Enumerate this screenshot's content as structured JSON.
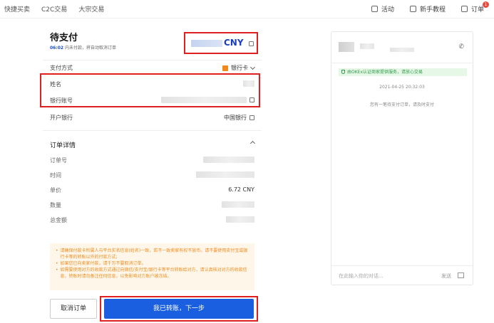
{
  "nav": {
    "left": [
      "快捷买卖",
      "C2C交易",
      "大宗交易"
    ],
    "activity": "活动",
    "tutorial": "新手教程",
    "orders": "订单",
    "orders_badge": "1"
  },
  "order": {
    "title": "待支付",
    "timer": "06:02",
    "timer_suffix": "内未付款，将自动取消订单",
    "currency": "CNY",
    "payment_method_label": "支付方式",
    "payment_method_value": "银行卡",
    "name_label": "姓名",
    "account_label": "银行账号",
    "bank_label": "开户银行",
    "bank_value": "中国银行",
    "details_title": "订单详情",
    "order_no_label": "订单号",
    "time_label": "时间",
    "price_label": "单价",
    "price_value": "6.72 CNY",
    "quantity_label": "数量",
    "total_label": "总金额",
    "warnings": [
      "请确保付款卡所属人与平台实名信息(姓名)一致，若不一致卖家有权不放币。请不要使用支付宝或银行卡等的转账以外的付款方式;",
      "如果您已向卖家付款，请千万不要取消订单。",
      "如需要使用对方的收款方式通过向微信/支付宝/银行卡等平台转账给对方，请认真核对对方的收款信息，转账时请勿备注任何信息，以免影响对方账户被冻结。"
    ],
    "cancel_label": "取消订单",
    "confirm_label": "我已转账，下一步"
  },
  "chat": {
    "notice": "由OKEx认证商家提供服务，请放心交易",
    "timestamp": "2021-04-25 20:32:03",
    "message": "您有一笔待支付订单，请及时支付",
    "input_placeholder": "在此输入你的对话...",
    "send_label": "发送"
  }
}
